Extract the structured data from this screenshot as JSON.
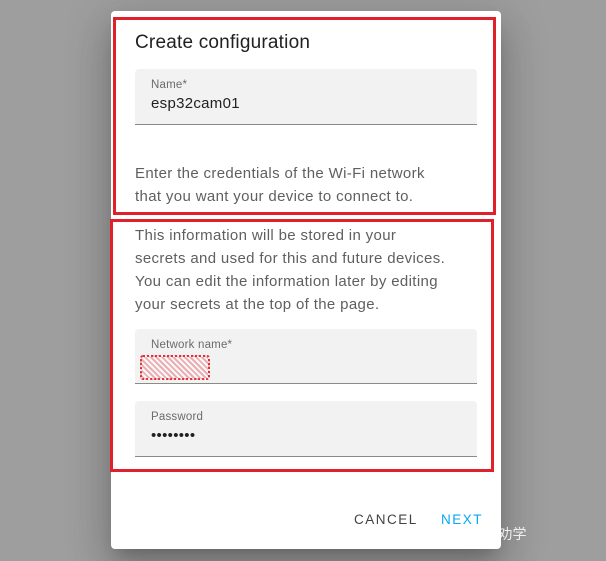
{
  "dialog": {
    "title": "Create configuration",
    "name_field": {
      "label": "Name*",
      "value": "esp32cam01"
    },
    "wifi_intro": [
      "Enter the credentials of the Wi-Fi network",
      "that you want your device to connect to."
    ],
    "secrets_info": [
      "This information will be stored in your",
      "secrets and used for this and future devices.",
      "You can edit the information later by editing",
      "your secrets at the top of the page."
    ],
    "network_field": {
      "label": "Network name*",
      "value": ""
    },
    "password_field": {
      "label": "Password",
      "value": "••••••••"
    },
    "actions": {
      "cancel": "CANCEL",
      "next": "NEXT"
    }
  },
  "watermark": "知乎 @劝学"
}
